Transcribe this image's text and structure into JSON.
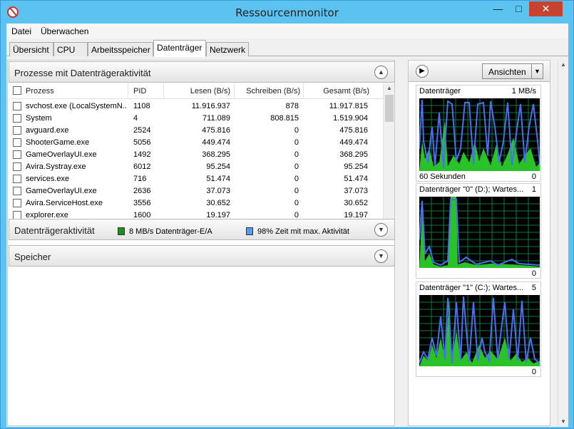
{
  "window": {
    "title": "Ressourcenmonitor",
    "min": "—",
    "max": "□",
    "close": "✕"
  },
  "menu": {
    "file": "Datei",
    "monitor": "Überwachen"
  },
  "tabs": [
    "Übersicht",
    "CPU",
    "Arbeitsspeicher",
    "Datenträger",
    "Netzwerk"
  ],
  "processes": {
    "title": "Prozesse mit Datenträgeraktivität",
    "columns": [
      "Prozess",
      "PID",
      "Lesen (B/s)",
      "Schreiben (B/s)",
      "Gesamt (B/s)"
    ],
    "rows": [
      {
        "name": "svchost.exe (LocalSystemN...",
        "pid": "1108",
        "read": "11.916.937",
        "write": "878",
        "total": "11.917.815"
      },
      {
        "name": "System",
        "pid": "4",
        "read": "711.089",
        "write": "808.815",
        "total": "1.519.904"
      },
      {
        "name": "avguard.exe",
        "pid": "2524",
        "read": "475.816",
        "write": "0",
        "total": "475.816"
      },
      {
        "name": "ShooterGame.exe",
        "pid": "5056",
        "read": "449.474",
        "write": "0",
        "total": "449.474"
      },
      {
        "name": "GameOverlayUI.exe",
        "pid": "1492",
        "read": "368.295",
        "write": "0",
        "total": "368.295"
      },
      {
        "name": "Avira.Systray.exe",
        "pid": "6012",
        "read": "95.254",
        "write": "0",
        "total": "95.254"
      },
      {
        "name": "services.exe",
        "pid": "716",
        "read": "51.474",
        "write": "0",
        "total": "51.474"
      },
      {
        "name": "GameOverlayUI.exe",
        "pid": "2636",
        "read": "37.073",
        "write": "0",
        "total": "37.073"
      },
      {
        "name": "Avira.ServiceHost.exe",
        "pid": "3556",
        "read": "30.652",
        "write": "0",
        "total": "30.652"
      },
      {
        "name": "explorer.exe",
        "pid": "1600",
        "read": "19.197",
        "write": "0",
        "total": "19.197"
      }
    ]
  },
  "disk_activity": {
    "title": "Datenträgeraktivität",
    "legend1": "8 MB/s Datenträger-E/A",
    "legend1_color": "#1a8f1a",
    "legend2": "98% Zeit mit max. Aktivität",
    "legend2_color": "#5a9be8"
  },
  "memory": {
    "title": "Speicher"
  },
  "side": {
    "views_label": "Ansichten",
    "graphs": [
      {
        "title": "Datenträger",
        "max": "1 MB/s",
        "footer_left": "60 Sekunden",
        "footer_right": "0"
      },
      {
        "title": "Datenträger \"0\" (D:); Wartes...",
        "max": "1",
        "footer_left": "",
        "footer_right": "0"
      },
      {
        "title": "Datenträger \"1\" (C:); Wartes...",
        "max": "5",
        "footer_left": "",
        "footer_right": "0"
      }
    ]
  },
  "colors": {
    "graph_bg": "#000000",
    "graph_grid": "#0b7a3a",
    "graph_line": "#4a6ff0",
    "graph_fill": "#29c229"
  }
}
